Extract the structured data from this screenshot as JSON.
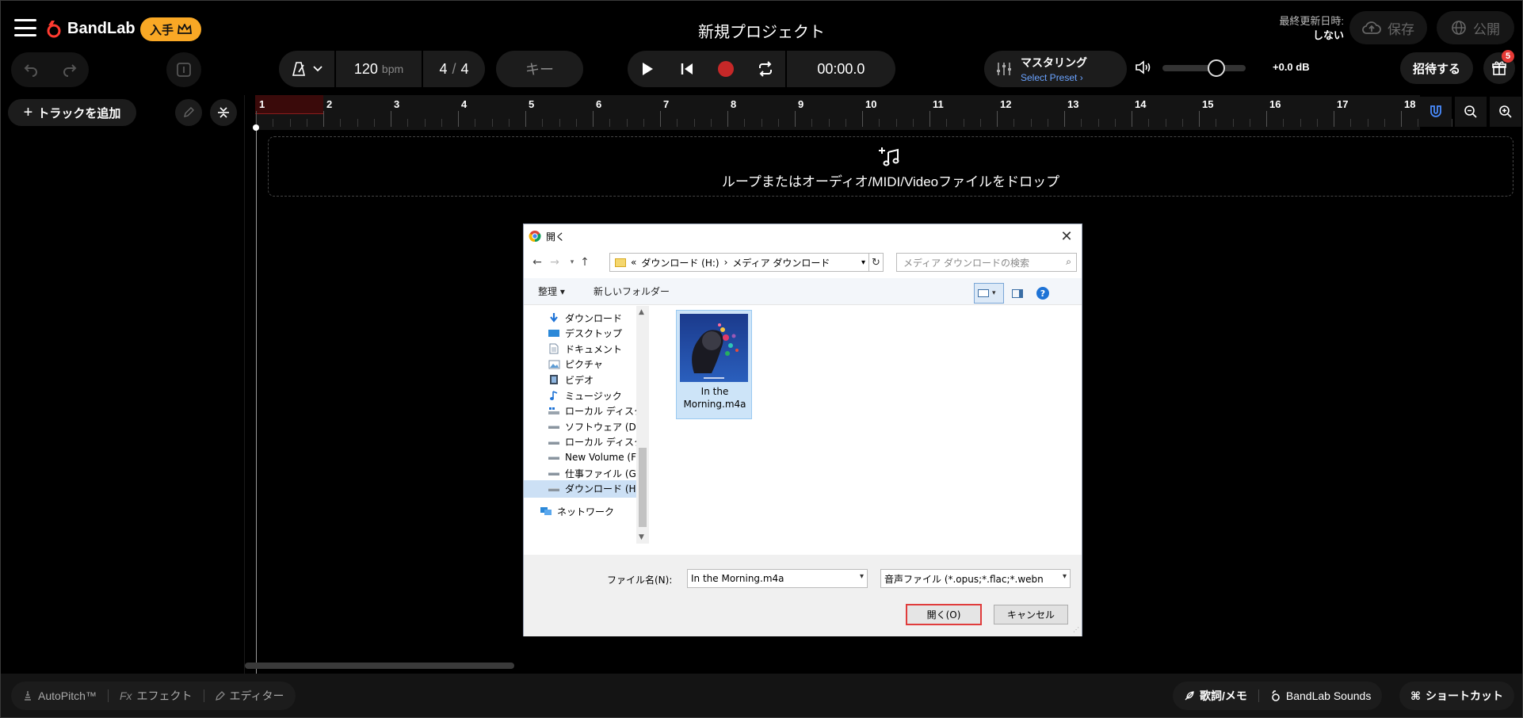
{
  "app": {
    "brand": "BandLab",
    "get_label": "入手",
    "project_title": "新規プロジェクト"
  },
  "status": {
    "last_saved_label": "最終更新日時:",
    "last_saved_value": "しない"
  },
  "header": {
    "save_label": "保存",
    "publish_label": "公開"
  },
  "transport": {
    "bpm_value": "120",
    "bpm_unit": "bpm",
    "time_signature_top": "4",
    "time_signature_sep": "/",
    "time_signature_bottom": "4",
    "key_label": "キー",
    "time_display": "00:00.0"
  },
  "mastering": {
    "title": "マスタリング",
    "preset_label": "Select Preset ›"
  },
  "volume": {
    "level_fraction": 0.55,
    "db_label": "+0.0 dB"
  },
  "actions": {
    "invite_label": "招待する",
    "gift_badge": "5"
  },
  "tracks": {
    "add_track_label": "トラックを追加"
  },
  "ruler": {
    "bars": [
      "1",
      "2",
      "3",
      "4",
      "5",
      "6",
      "7",
      "8",
      "9",
      "10",
      "11",
      "12",
      "13",
      "14",
      "15",
      "16",
      "17",
      "18"
    ]
  },
  "dropzone": {
    "text": "ループまたはオーディオ/MIDI/Videoファイルをドロップ"
  },
  "bottom": {
    "autopitch_label": "AutoPitch™",
    "fx_prefix": "Fx",
    "effects_label": "エフェクト",
    "editor_label": "エディター",
    "lyrics_label": "歌詞/メモ",
    "sounds_label": "BandLab Sounds",
    "shortcuts_label": "ショートカット"
  },
  "dialog": {
    "title": "開く",
    "address_prefix": "«",
    "address_part1": "ダウンロード (H:)",
    "address_sep": "›",
    "address_part2": "メディア ダウンロード",
    "search_placeholder": "メディア ダウンロードの検索",
    "organize_label": "整理 ▾",
    "new_folder_label": "新しいフォルダー",
    "tree": [
      {
        "label": "ダウンロード",
        "icon": "download-arrow-icon"
      },
      {
        "label": "デスクトップ",
        "icon": "desktop-icon"
      },
      {
        "label": "ドキュメント",
        "icon": "document-icon"
      },
      {
        "label": "ピクチャ",
        "icon": "pictures-icon"
      },
      {
        "label": "ビデオ",
        "icon": "video-icon"
      },
      {
        "label": "ミュージック",
        "icon": "music-icon"
      },
      {
        "label": "ローカル ディスク (C:",
        "icon": "system-drive-icon"
      },
      {
        "label": "ソフトウェア (D:)",
        "icon": "drive-icon"
      },
      {
        "label": "ローカル ディスク (E:",
        "icon": "drive-icon"
      },
      {
        "label": "New Volume (F:)",
        "icon": "drive-icon"
      },
      {
        "label": "仕事ファイル (G:)",
        "icon": "drive-icon"
      },
      {
        "label": "ダウンロード (H:)",
        "icon": "drive-icon"
      },
      {
        "label": "ネットワーク",
        "icon": "network-icon"
      }
    ],
    "file": {
      "name_line1": "In the",
      "name_line2": "Morning.m4a"
    },
    "filename_label": "ファイル名(N):",
    "filename_value": "In the Morning.m4a",
    "filetype_value": "音声ファイル (*.opus;*.flac;*.webn",
    "open_label": "開く(O)",
    "cancel_label": "キャンセル",
    "help_label": "?"
  },
  "colors": {
    "accent": "#f9a825",
    "record": "#c62828",
    "link": "#6aa3ff",
    "background": "#000000",
    "loop_region": "#3a0a0a",
    "badge": "#e53935"
  }
}
